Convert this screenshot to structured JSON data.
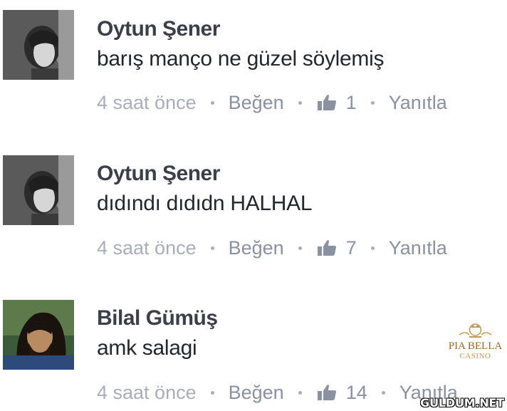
{
  "comments": [
    {
      "author": "Oytun Şener",
      "text": "barış manço ne güzel söylemiş",
      "time": "4 saat önce",
      "like_label": "Beğen",
      "like_count": "1",
      "reply_label": "Yanıtla",
      "avatar_icon": "profile-photo-woman-bw"
    },
    {
      "author": "Oytun Şener",
      "text": "dıdındı dıdıdn HALHAL",
      "time": "4 saat önce",
      "like_label": "Beğen",
      "like_count": "7",
      "reply_label": "Yanıtla",
      "avatar_icon": "profile-photo-woman-bw"
    },
    {
      "author": "Bilal Gümüş",
      "text": "amk salagi",
      "time": "4 saat önce",
      "like_label": "Beğen",
      "like_count": "14",
      "reply_label": "Yanıtla",
      "avatar_icon": "profile-photo-man-long-hair"
    }
  ],
  "ad": {
    "brand_name": "PIA BELLA",
    "brand_sub": "CASINO",
    "logo_icon": "crown-logo"
  },
  "watermark": "GULDUM.NET",
  "colors": {
    "author": "#3b3f4a",
    "meta": "#8e95a3",
    "ad_gold": "#b07d35"
  }
}
